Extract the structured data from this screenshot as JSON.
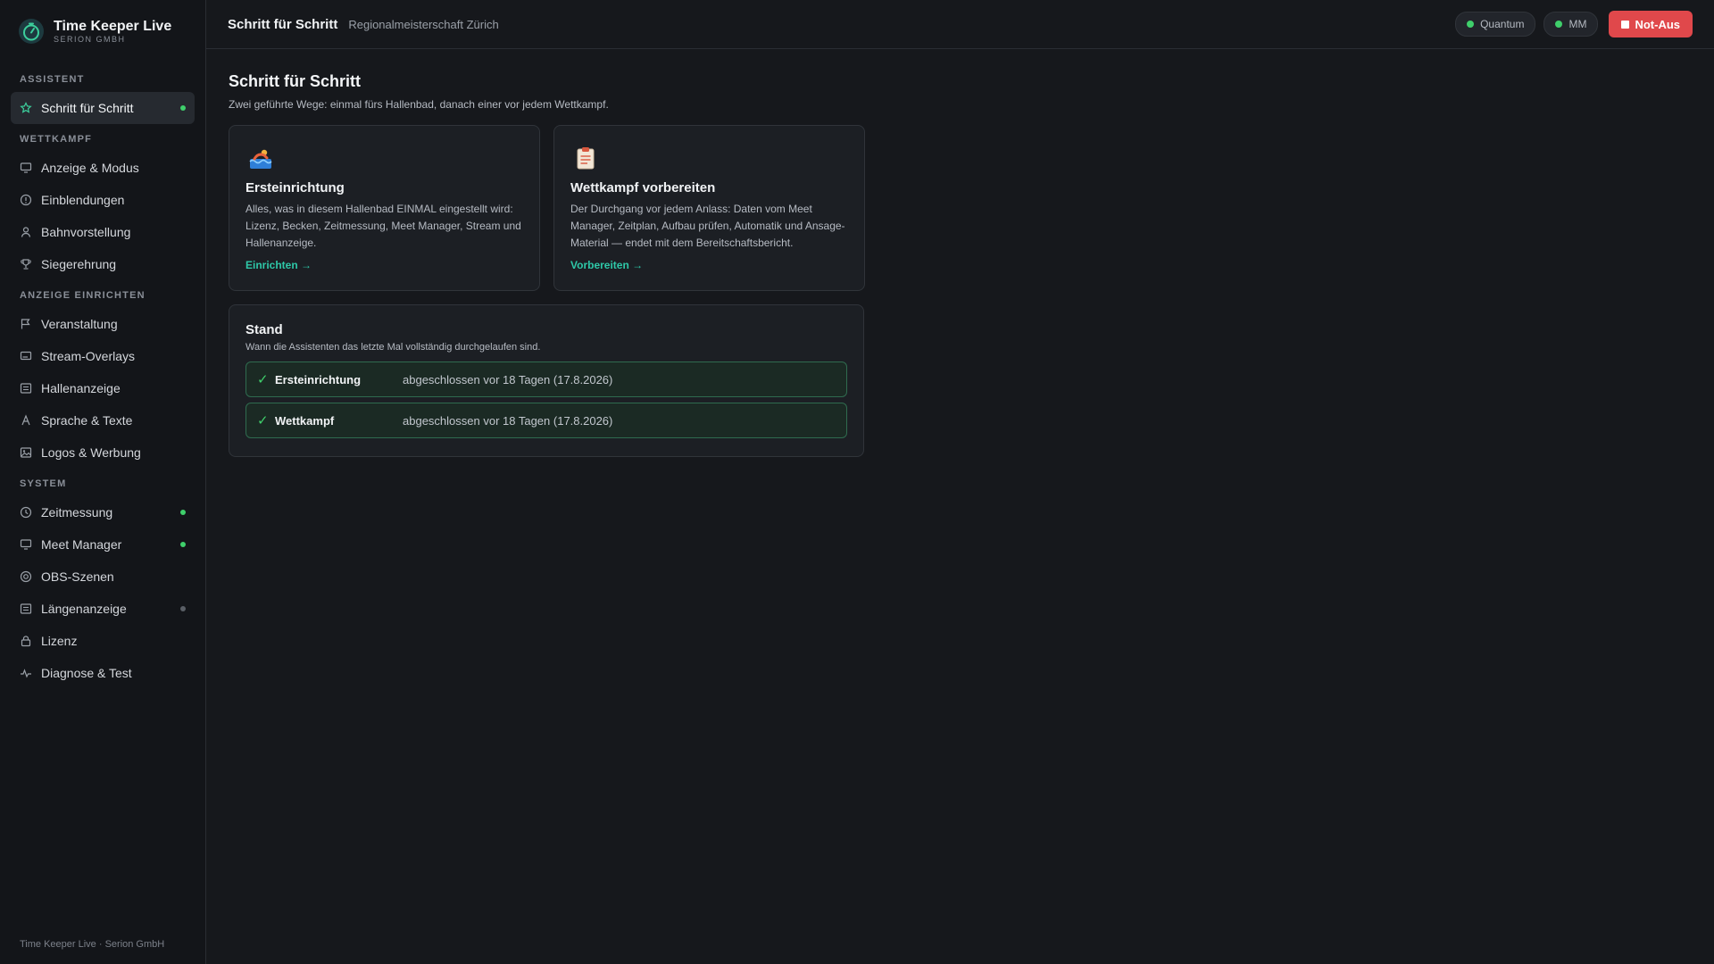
{
  "brand": {
    "title": "Time Keeper Live",
    "subtitle": "SERION GMBH"
  },
  "sidebar": {
    "sections": [
      {
        "label": "ASSISTENT",
        "items": [
          {
            "label": "Schritt für Schritt",
            "icon": "star-icon",
            "active": true,
            "status": "green"
          }
        ]
      },
      {
        "label": "WETTKAMPF",
        "items": [
          {
            "label": "Anzeige & Modus",
            "icon": "monitor-icon"
          },
          {
            "label": "Einblendungen",
            "icon": "info-circle-icon"
          },
          {
            "label": "Bahnvorstellung",
            "icon": "person-icon"
          },
          {
            "label": "Siegerehrung",
            "icon": "trophy-icon"
          }
        ]
      },
      {
        "label": "ANZEIGE EINRICHTEN",
        "items": [
          {
            "label": "Veranstaltung",
            "icon": "flag-icon"
          },
          {
            "label": "Stream-Overlays",
            "icon": "overlay-icon"
          },
          {
            "label": "Hallenanzeige",
            "icon": "list-panel-icon"
          },
          {
            "label": "Sprache & Texte",
            "icon": "language-icon"
          },
          {
            "label": "Logos & Werbung",
            "icon": "image-icon"
          }
        ]
      },
      {
        "label": "SYSTEM",
        "items": [
          {
            "label": "Zeitmessung",
            "icon": "clock-icon",
            "status": "green"
          },
          {
            "label": "Meet Manager",
            "icon": "monitor-icon",
            "status": "green"
          },
          {
            "label": "OBS-Szenen",
            "icon": "target-icon"
          },
          {
            "label": "Längenanzeige",
            "icon": "list-panel-icon",
            "status": "gray"
          },
          {
            "label": "Lizenz",
            "icon": "lock-icon"
          },
          {
            "label": "Diagnose & Test",
            "icon": "pulse-icon"
          }
        ]
      }
    ],
    "footer": "Time Keeper Live · Serion GmbH"
  },
  "topbar": {
    "title": "Schritt für Schritt",
    "subtitle": "Regionalmeisterschaft Zürich",
    "pills": [
      {
        "label": "Quantum",
        "status": "green"
      },
      {
        "label": "MM",
        "status": "green"
      }
    ],
    "emergency_label": "Not-Aus"
  },
  "main": {
    "title": "Schritt für Schritt",
    "lead": "Zwei geführte Wege: einmal fürs Hallenbad, danach einer vor jedem Wettkampf.",
    "cards": [
      {
        "icon": "swimmer-icon",
        "title": "Ersteinrichtung",
        "text": "Alles, was in diesem Hallenbad EINMAL eingestellt wird: Lizenz, Becken, Zeitmessung, Meet Manager, Stream und Hallenanzeige.",
        "link": "Einrichten →"
      },
      {
        "icon": "clipboard-icon",
        "title": "Wettkampf vorbereiten",
        "text": "Der Durchgang vor jedem Anlass: Daten vom Meet Manager, Zeitplan, Aufbau prüfen, Automatik und Ansage-Material — endet mit dem Bereitschaftsbericht.",
        "link": "Vorbereiten →"
      }
    ],
    "stand": {
      "title": "Stand",
      "subtitle": "Wann die Assistenten das letzte Mal vollständig durchgelaufen sind.",
      "rows": [
        {
          "check": "✓",
          "name": "Ersteinrichtung",
          "text": "abgeschlossen vor 18 Tagen (17.8.2026)"
        },
        {
          "check": "✓",
          "name": "Wettkampf",
          "text": "abgeschlossen vor 18 Tagen (17.8.2026)"
        }
      ]
    }
  },
  "colors": {
    "accent": "#2ec8a8",
    "ok": "#3fcf6b",
    "danger": "#e0484b",
    "inactive": "#5a5f66"
  }
}
